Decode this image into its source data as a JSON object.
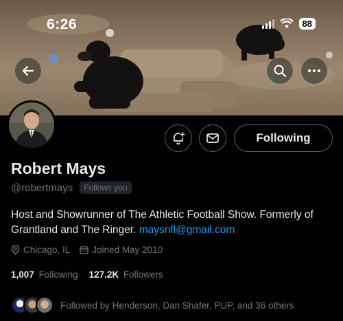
{
  "status_bar": {
    "time": "6:26",
    "battery": "88"
  },
  "profile": {
    "name": "Robert Mays",
    "handle": "@robertmays",
    "follows_you": "Follows you",
    "bio_text": "Host and Showrunner of The Athletic Football Show. Formerly of Grantland and The Ringer.",
    "bio_link": "maysnfl@gmail.com",
    "location": "Chicago, IL",
    "joined": "Joined May 2010"
  },
  "actions": {
    "following_label": "Following"
  },
  "stats": {
    "following_count": "1,007",
    "following_label": "Following",
    "followers_count": "127.2K",
    "followers_label": "Followers"
  },
  "followed_by": {
    "text": "Followed by Henderson, Dan Shafer, PUP, and 36 others"
  },
  "colors": {
    "background": "#000000",
    "link": "#1d9bf0",
    "secondary_text": "#71767b",
    "border": "#536471"
  },
  "icons": [
    "back-arrow-icon",
    "search-icon",
    "more-icon",
    "bell-plus-icon",
    "mail-icon",
    "location-pin-icon",
    "calendar-icon",
    "wifi-icon",
    "signal-icon"
  ]
}
